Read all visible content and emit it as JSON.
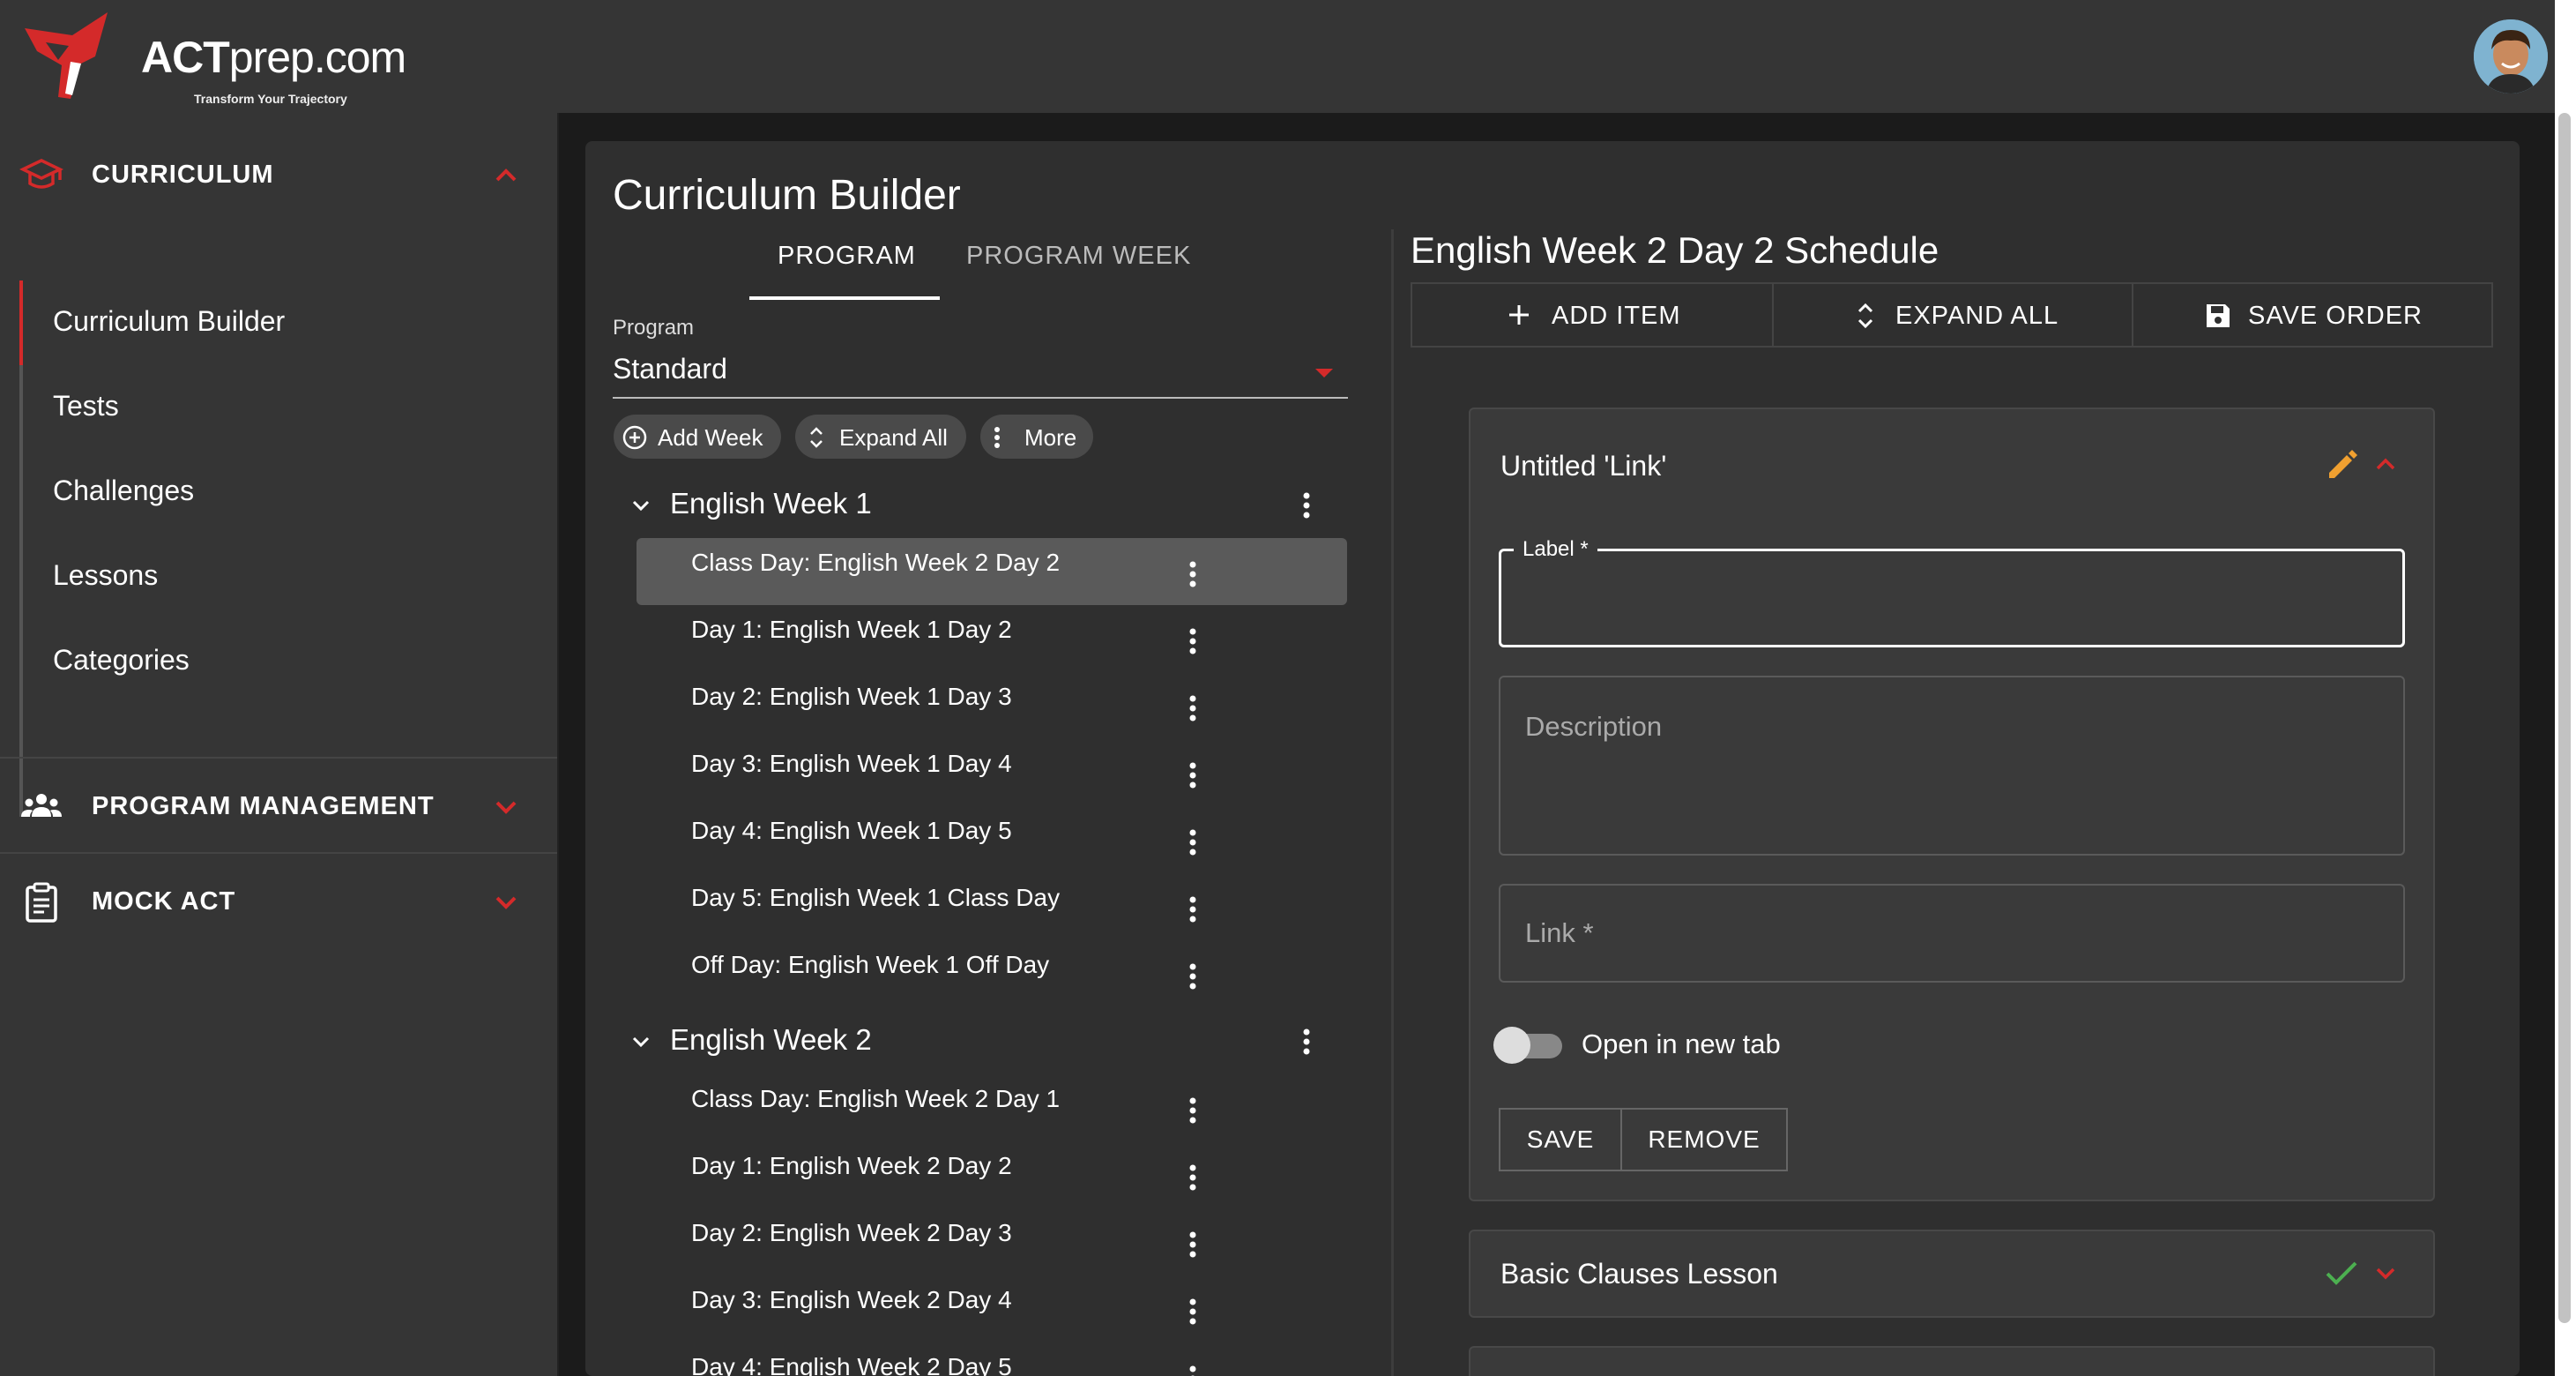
{
  "app": {
    "brand_bold": "ACT",
    "brand_rest": "prep.com",
    "tagline": "Transform Your Trajectory",
    "brand_color": "#d42a2a",
    "avatar_icon": "user-avatar"
  },
  "sidebar": {
    "sections": [
      {
        "label": "CURRICULUM",
        "icon": "graduation-cap-icon",
        "expanded": true
      },
      {
        "label": "PROGRAM MANAGEMENT",
        "icon": "users-icon",
        "expanded": false
      },
      {
        "label": "MOCK ACT",
        "icon": "clipboard-icon",
        "expanded": false
      }
    ],
    "items": [
      {
        "label": "Curriculum Builder",
        "active": true
      },
      {
        "label": "Tests"
      },
      {
        "label": "Challenges"
      },
      {
        "label": "Lessons"
      },
      {
        "label": "Categories"
      }
    ]
  },
  "main": {
    "title": "Curriculum Builder",
    "tabs": [
      {
        "label": "PROGRAM",
        "active": true
      },
      {
        "label": "PROGRAM WEEK"
      }
    ],
    "program": {
      "label": "Program",
      "value": "Standard"
    },
    "actions": {
      "add_week": "Add Week",
      "expand_all": "Expand All",
      "more": "More"
    },
    "weeks": [
      {
        "title": "English Week 1",
        "days": [
          "Class Day: English Week 2 Day 2",
          "Day 1: English Week 1 Day 2",
          "Day 2: English Week 1 Day 3",
          "Day 3: English Week 1 Day 4",
          "Day 4: English Week 1 Day 5",
          "Day 5: English Week 1 Class Day",
          "Off Day: English Week 1 Off Day"
        ]
      },
      {
        "title": "English Week 2",
        "days": [
          "Class Day: English Week 2 Day 1",
          "Day 1: English Week 2 Day 2",
          "Day 2: English Week 2 Day 3",
          "Day 3: English Week 2 Day 4",
          "Day 4: English Week 2 Day 5"
        ]
      }
    ]
  },
  "schedule": {
    "title": "English Week 2 Day 2 Schedule",
    "toolbar": {
      "add_item": "ADD ITEM",
      "expand_all": "EXPAND ALL",
      "save_order": "SAVE ORDER"
    },
    "item_open": {
      "title": "Untitled 'Link'",
      "label_field": {
        "label": "Label *",
        "value": ""
      },
      "description_placeholder": "Description",
      "link_placeholder": "Link *",
      "toggle_label": "Open in new tab",
      "toggle_on": false,
      "save": "SAVE",
      "remove": "REMOVE"
    },
    "item_collapsed": {
      "title": "Basic Clauses Lesson"
    },
    "accent_edit": "#f0a030",
    "accent_check": "#4caf50"
  }
}
